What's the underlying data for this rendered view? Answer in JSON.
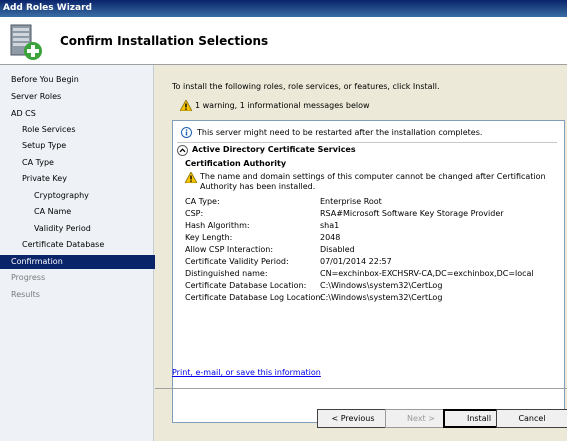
{
  "window": {
    "title": "Add Roles Wizard"
  },
  "header": {
    "title": "Confirm Installation Selections"
  },
  "sidebar": {
    "items": [
      {
        "label": "Before You Begin",
        "level": 0,
        "state": "normal"
      },
      {
        "label": "Server Roles",
        "level": 0,
        "state": "normal"
      },
      {
        "label": "AD CS",
        "level": 0,
        "state": "normal"
      },
      {
        "label": "Role Services",
        "level": 1,
        "state": "normal"
      },
      {
        "label": "Setup Type",
        "level": 1,
        "state": "normal"
      },
      {
        "label": "CA Type",
        "level": 1,
        "state": "normal"
      },
      {
        "label": "Private Key",
        "level": 1,
        "state": "normal"
      },
      {
        "label": "Cryptography",
        "level": 2,
        "state": "normal"
      },
      {
        "label": "CA Name",
        "level": 2,
        "state": "normal"
      },
      {
        "label": "Validity Period",
        "level": 2,
        "state": "normal"
      },
      {
        "label": "Certificate Database",
        "level": 1,
        "state": "normal"
      },
      {
        "label": "Confirmation",
        "level": 0,
        "state": "active"
      },
      {
        "label": "Progress",
        "level": 0,
        "state": "disabled"
      },
      {
        "label": "Results",
        "level": 0,
        "state": "disabled"
      }
    ]
  },
  "main": {
    "intro": "To install the following roles, role services, or features, click Install.",
    "messages_summary": "1 warning, 1 informational messages below",
    "info_message": "This server might need to be restarted after the installation completes.",
    "section_title": "Active Directory Certificate Services",
    "subsection_title": "Certification Authority",
    "warning_message": "The name and domain settings of this computer cannot be changed after Certification Authority has been installed.",
    "details": [
      {
        "key": "CA Type:",
        "value": "Enterprise Root"
      },
      {
        "key": "CSP:",
        "value": "RSA#Microsoft Software Key Storage Provider"
      },
      {
        "key": "Hash Algorithm:",
        "value": "sha1"
      },
      {
        "key": "Key Length:",
        "value": "2048"
      },
      {
        "key": "Allow CSP Interaction:",
        "value": "Disabled"
      },
      {
        "key": "Certificate Validity Period:",
        "value": "07/01/2014 22:57"
      },
      {
        "key": "Distinguished name:",
        "value": "CN=exchinbox-EXCHSRV-CA,DC=exchinbox,DC=local"
      },
      {
        "key": "Certificate Database Location:",
        "value": "C:\\Windows\\system32\\CertLog"
      },
      {
        "key": "Certificate Database Log Location:",
        "value": "C:\\Windows\\system32\\CertLog"
      }
    ],
    "print_link": "Print, e-mail, or save this information"
  },
  "buttons": {
    "previous": "< Previous",
    "next": "Next >",
    "install": "Install",
    "cancel": "Cancel"
  },
  "colors": {
    "accent": "#0a246a",
    "link": "#0000ee",
    "warning": "#f5c400",
    "info": "#1c5fb4"
  }
}
